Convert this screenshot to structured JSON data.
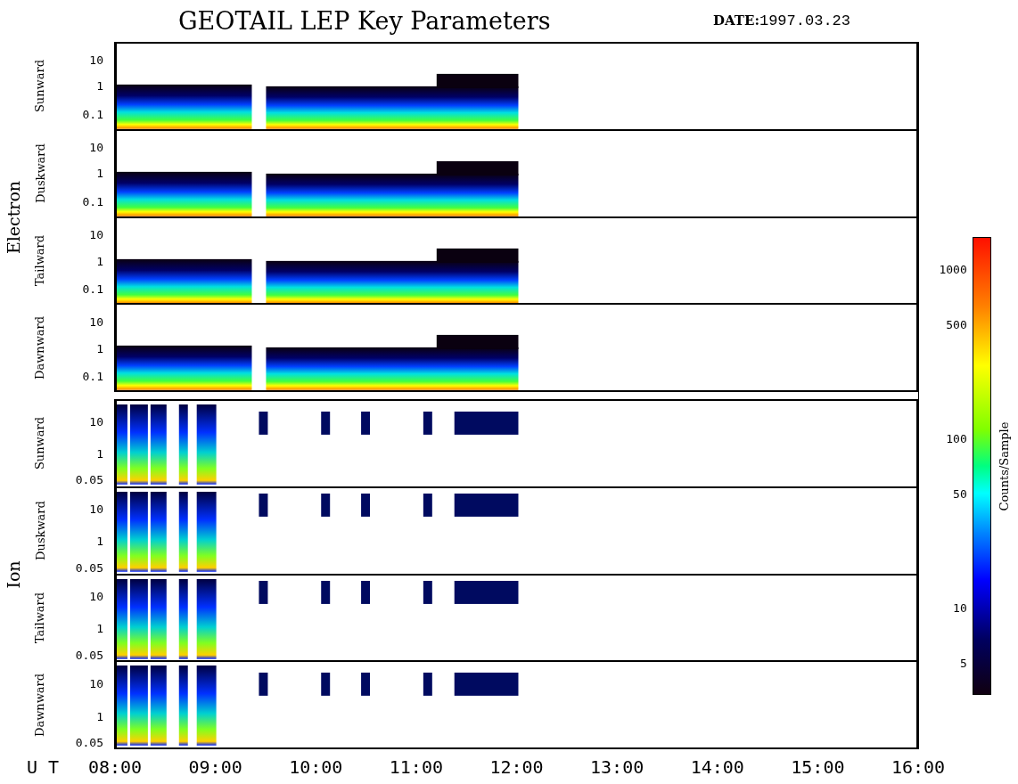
{
  "title": "GEOTAIL LEP Key Parameters",
  "date_label": "DATE:",
  "date": "1997.03.23",
  "groups": [
    {
      "label": "Electron",
      "kind": "electron",
      "panels": [
        {
          "label": "Sunward",
          "yticks": [
            "10",
            "1",
            "0.1"
          ]
        },
        {
          "label": "Duskward",
          "yticks": [
            "10",
            "1",
            "0.1"
          ]
        },
        {
          "label": "Tailward",
          "yticks": [
            "10",
            "1",
            "0.1"
          ]
        },
        {
          "label": "Dawnward",
          "yticks": [
            "10",
            "1",
            "0.1"
          ]
        }
      ]
    },
    {
      "label": "Ion",
      "kind": "ion",
      "panels": [
        {
          "label": "Sunward",
          "yticks": [
            "10",
            "1",
            "0.05"
          ]
        },
        {
          "label": "Duskward",
          "yticks": [
            "10",
            "1",
            "0.05"
          ]
        },
        {
          "label": "Tailward",
          "yticks": [
            "10",
            "1",
            "0.05"
          ]
        },
        {
          "label": "Dawnward",
          "yticks": [
            "10",
            "1",
            "0.05"
          ]
        }
      ]
    }
  ],
  "time_axis": {
    "label": "U T",
    "ticks": [
      "08:00",
      "09:00",
      "10:00",
      "11:00",
      "12:00",
      "13:00",
      "14:00",
      "15:00",
      "16:00"
    ]
  },
  "colorbar": {
    "label": "Counts/Sample",
    "ticks": [
      "1000",
      "500",
      "100",
      "50",
      "10",
      "5"
    ]
  }
}
